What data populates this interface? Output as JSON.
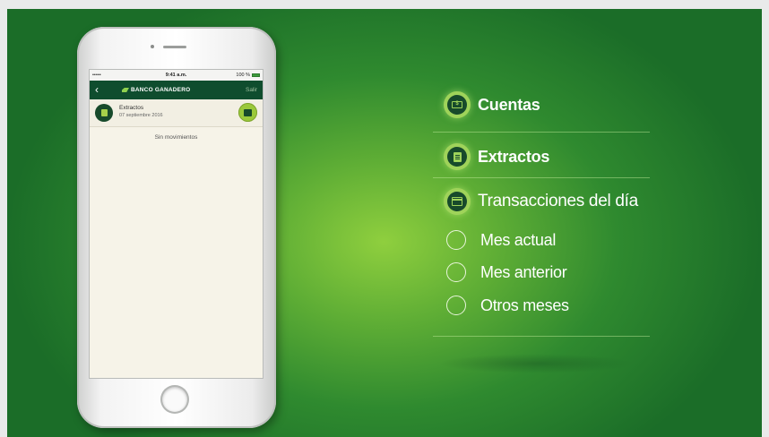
{
  "phone": {
    "status": {
      "carrier": "•••••",
      "time": "9:41 a.m.",
      "battery": "100 %"
    },
    "appbar": {
      "back_icon": "‹",
      "brand": "BANCO GANADERO",
      "exit": "Salir"
    },
    "row": {
      "title": "Extractos",
      "date": "07 septiembre 2016"
    },
    "empty_text": "Sin movimientos"
  },
  "menu": {
    "cuentas": "Cuentas",
    "extractos": "Extractos",
    "transacciones": "Transacciones del día",
    "options": [
      "Mes actual",
      "Mes anterior",
      "Otros meses"
    ]
  },
  "colors": {
    "accent": "#9fd35a",
    "dark_green": "#0f4d2e"
  }
}
